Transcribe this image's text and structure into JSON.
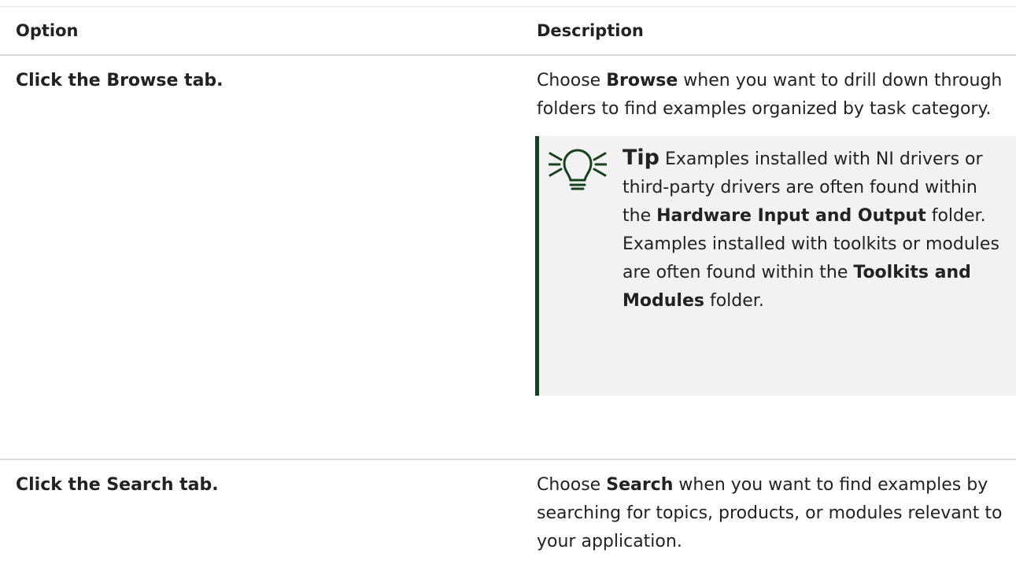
{
  "table": {
    "headers": {
      "option": "Option",
      "description": "Description"
    },
    "rows": [
      {
        "option": "Click the Browse tab.",
        "description": {
          "pre": "Choose ",
          "bold": "Browse",
          "post": " when you want to drill down through folders to find examples organized by task category."
        },
        "tip": {
          "icon": "lightbulb-icon",
          "label": "Tip",
          "text_1": " Examples installed with NI drivers or third-party drivers are often found within the ",
          "bold_1": "Hardware Input and Output",
          "text_2": " folder. Examples installed with toolkits or modules are often found within the ",
          "bold_2": "Toolkits and Modules",
          "text_3": " folder."
        }
      },
      {
        "option": "Click the Search tab.",
        "description": {
          "pre": "Choose ",
          "bold": "Search",
          "post": " when you want to find examples by searching for topics, products, or modules relevant to your application."
        }
      }
    ]
  },
  "colors": {
    "tip_accent": "#17421e",
    "tip_background": "#f2f2f2",
    "divider": "#d9d9d9"
  }
}
